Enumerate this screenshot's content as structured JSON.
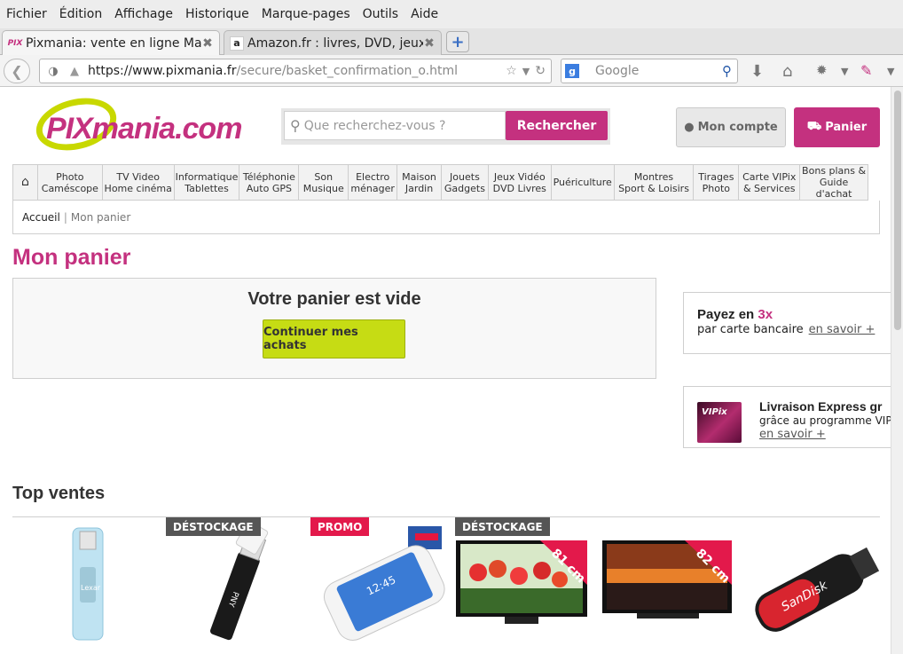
{
  "browser": {
    "menu": [
      "Fichier",
      "Édition",
      "Affichage",
      "Historique",
      "Marque-pages",
      "Outils",
      "Aide"
    ],
    "tabs": [
      {
        "title": "Pixmania: vente en ligne Mat...",
        "favicon": "PIX"
      },
      {
        "title": "Amazon.fr : livres, DVD, jeux ...",
        "favicon": "a"
      }
    ],
    "url_host": "https://www.pixmania.fr",
    "url_path": "/secure/basket_confirmation_o.html",
    "search_placeholder": "Google"
  },
  "site": {
    "logo_text": "PIXmania.com",
    "search_placeholder": "Que recherchez-vous ?",
    "search_button": "Rechercher",
    "account_button": "Mon compte",
    "cart_button": "Panier",
    "categories": [
      {
        "l1": "Photo",
        "l2": "Caméscope"
      },
      {
        "l1": "TV Video",
        "l2": "Home cinéma"
      },
      {
        "l1": "Informatique",
        "l2": "Tablettes"
      },
      {
        "l1": "Téléphonie",
        "l2": "Auto GPS"
      },
      {
        "l1": "Son",
        "l2": "Musique"
      },
      {
        "l1": "Electro",
        "l2": "ménager"
      },
      {
        "l1": "Maison",
        "l2": "Jardin"
      },
      {
        "l1": "Jouets",
        "l2": "Gadgets"
      },
      {
        "l1": "Jeux Vidéo",
        "l2": "DVD Livres"
      },
      {
        "l1": "Puériculture",
        "l2": ""
      },
      {
        "l1": "Montres",
        "l2": "Sport & Loisirs"
      },
      {
        "l1": "Tirages",
        "l2": "Photo"
      },
      {
        "l1": "Carte VIPix",
        "l2": "& Services"
      },
      {
        "l1": "Bons plans &",
        "l2": "Guide d'achat"
      }
    ],
    "breadcrumb": {
      "home": "Accueil",
      "sep": "|",
      "current": "Mon panier"
    },
    "page_title": "Mon panier",
    "empty_message": "Votre panier est vide",
    "continue_button": "Continuer mes achats",
    "promo_pay": {
      "title_prefix": "Payez en ",
      "title_highlight": "3x",
      "subtitle": "par carte bancaire",
      "link": "en savoir +"
    },
    "promo_delivery": {
      "title": "Livraison Express gr",
      "subtitle": "grâce au programme VIPi",
      "link": "en savoir +",
      "card_label": "VIPix"
    },
    "top_sales_title": "Top ventes",
    "products": [
      {
        "name": "usb-key-lexar",
        "badge": "",
        "label": "Lexar"
      },
      {
        "name": "usb-key-pny",
        "badge": "DÉSTOCKAGE",
        "label": "PNY"
      },
      {
        "name": "smartphone",
        "badge": "PROMO",
        "label": ""
      },
      {
        "name": "tv-tulips",
        "badge": "DÉSTOCKAGE",
        "label": "81 cm"
      },
      {
        "name": "tv-sunset",
        "badge": "",
        "label": "82 cm"
      },
      {
        "name": "usb-key-sandisk",
        "badge": "",
        "label": "SanDisk"
      }
    ]
  }
}
